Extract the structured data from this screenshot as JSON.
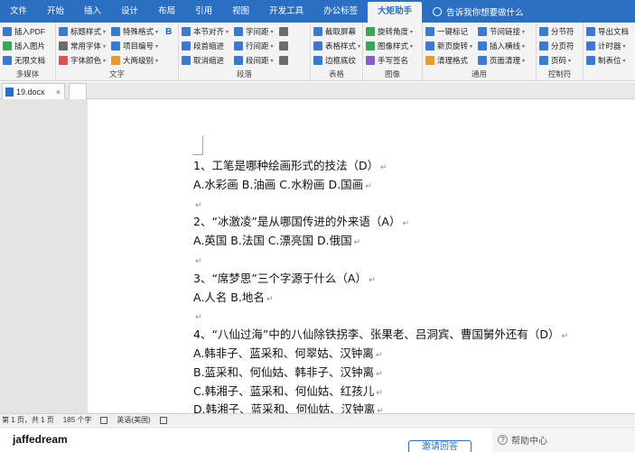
{
  "menu": {
    "tabs": [
      "文件",
      "开始",
      "插入",
      "设计",
      "布局",
      "引用",
      "视图",
      "开发工具",
      "办公标签",
      "大矩助手"
    ],
    "active_tab": "大矩助手",
    "search_label": "告诉我你想要做什么"
  },
  "ribbon": {
    "g1": {
      "items": [
        "插入PDF",
        "插入图片",
        "无限文档"
      ],
      "label": "多媒体"
    },
    "g2": {
      "col1": [
        "标题样式",
        "常用字体",
        "字体颜色"
      ],
      "col2": [
        "特殊格式",
        "项目编号",
        "大两级别"
      ],
      "label": "文字"
    },
    "g3": {
      "col1": [
        "本节对齐",
        "段首缩进",
        "取消缩进"
      ],
      "col2": [
        "字间距",
        "行间距",
        "段间距"
      ],
      "label": "段落"
    },
    "g4": {
      "items": [
        "截取屏幕",
        "表格样式",
        "边框底纹"
      ],
      "label": "表格"
    },
    "g5": {
      "items": [
        "旋转角度",
        "图像样式",
        "手写签名"
      ],
      "label": "图像"
    },
    "g6": {
      "col1": [
        "一键标记",
        "新页旋转",
        "清理格式"
      ],
      "col2": [
        "节间链接",
        "插入横线",
        "页面清理"
      ],
      "label": "通用"
    },
    "g7": {
      "items": [
        "分节符",
        "分页符",
        "页码"
      ],
      "label": "控制符"
    },
    "g8": {
      "items": [
        "导出文档",
        "计时器",
        "制表位"
      ],
      "label": ""
    }
  },
  "doc_tab": {
    "name": "19.docx",
    "close": "×"
  },
  "document": {
    "lines": [
      "1、工笔是哪种绘画形式的技法（D）",
      "A.水彩画 B.油画 C.水粉画 D.国画",
      "",
      "2、“冰激凌”是从哪国传进的外来语（A）",
      "A.英国 B.法国 C.漂亮国 D.俄国",
      "",
      "3、“席梦思”三个字源于什么（A）",
      "A.人名 B.地名",
      "",
      "4、“八仙过海”中的八仙除铁拐李、张果老、吕洞宾、曹国舅外还有（D）",
      "A.韩非子、蓝采和、何翠姑、汉钟离",
      "B.蓝采和、何仙姑、韩非子、汉钟离",
      "C.韩湘子、蓝采和、何仙姑、红孩儿",
      "D.韩湘子、蓝采和、何仙姑、汉钟离"
    ],
    "para_mark": "↵"
  },
  "status": {
    "page": "第 1 页，共 1 页",
    "words": "185 个字",
    "lang": "英语(美国)"
  },
  "bottom": {
    "user": "jaffedream",
    "invite": "邀请回答",
    "help": "帮助中心"
  },
  "colors": {
    "menu_bg": "#2b6fc2",
    "ribbon_bg": "#f3f3f3"
  }
}
